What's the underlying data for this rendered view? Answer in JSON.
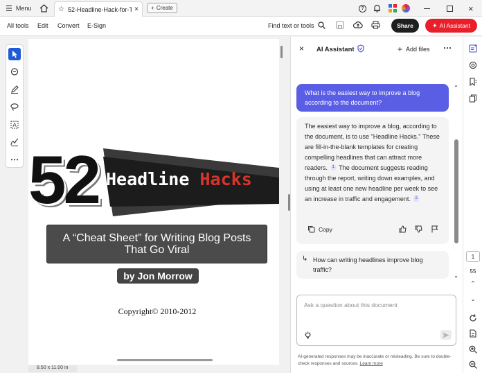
{
  "titlebar": {
    "menu_label": "Menu",
    "tab_title": "52-Headline-Hack-for-T...",
    "create_label": "Create"
  },
  "toolbar": {
    "items": [
      "All tools",
      "Edit",
      "Convert",
      "E-Sign"
    ],
    "find_label": "Find text or tools",
    "share_label": "Share",
    "ai_label": "AI Assistant"
  },
  "document": {
    "big_number": "52",
    "banner_word1": "Headline",
    "banner_word2": "Hacks",
    "subtitle_line1": "A “Cheat Sheet” for Writing Blog Posts",
    "subtitle_line2": "That Go Viral",
    "author": "by Jon Morrow",
    "copyright": "Copyright© 2010-2012",
    "page_size": "8.50 x 11.00 in"
  },
  "ai_panel": {
    "title": "AI Assistant",
    "add_files_label": "Add files",
    "user_question": "What is the easiest way to improve a blog according to the document?",
    "answer_part1": "The easiest way to improve a blog, according to the document, is to use \"Headline Hacks.\" These are fill-in-the-blank templates for creating compelling headlines that can attract more readers.",
    "cite1": "1",
    "answer_part2": "The document suggests reading through the report, writing down examples, and using at least one new headline per week to see an increase in traffic and engagement.",
    "cite2": "2",
    "copy_label": "Copy",
    "suggested_question": "How can writing headlines improve blog traffic?",
    "input_placeholder": "Ask a question about this document",
    "disclaimer": "AI-generated responses may be inaccurate or misleading. Be sure to double-check responses and sources.",
    "learn_more": "Learn more"
  },
  "right_rail": {
    "page_current": "1",
    "page_total": "55"
  },
  "colors": {
    "accent_blue": "#5a5ee5",
    "ai_red": "#e8202a",
    "hacks_red": "#d9342b"
  }
}
